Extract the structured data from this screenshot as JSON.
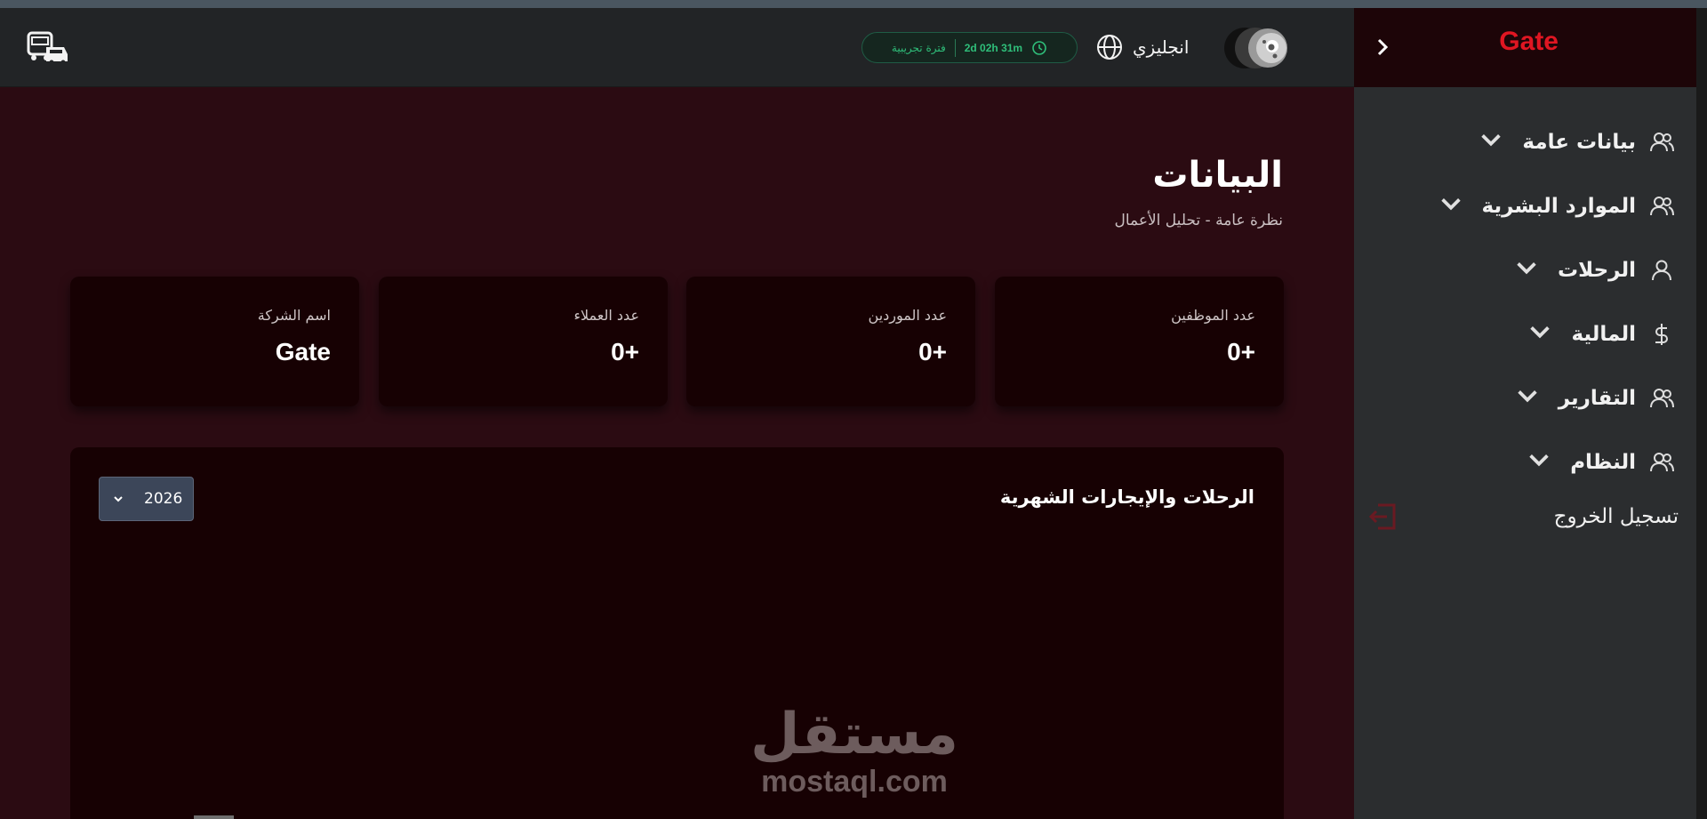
{
  "header": {
    "trial_label": "فترة تجريبية",
    "trial_time": "2d 02h 31m",
    "language_label": "انجليزي"
  },
  "sidebar": {
    "brand": "Gate",
    "items": [
      {
        "label": "بيانات عامة",
        "icon": "users-icon"
      },
      {
        "label": "الموارد البشرية",
        "icon": "users-icon"
      },
      {
        "label": "الرحلات",
        "icon": "user-icon"
      },
      {
        "label": "المالية",
        "icon": "dollar-icon"
      },
      {
        "label": "التقارير",
        "icon": "users-icon"
      },
      {
        "label": "النظام",
        "icon": "users-icon"
      }
    ],
    "logout_label": "تسجيل الخروج"
  },
  "main": {
    "title": "البيانات",
    "subtitle": "نظرة عامة - تحليل الأعمال",
    "cards": [
      {
        "label": "عدد الموظفين",
        "value": "0+"
      },
      {
        "label": "عدد الموردين",
        "value": "0+"
      },
      {
        "label": "عدد العملاء",
        "value": "0+"
      },
      {
        "label": "اسم الشركة",
        "value": "Gate"
      }
    ],
    "chart_title": "الرحلات والإيجارات الشهرية",
    "year_value": "2026"
  },
  "watermark": {
    "arabic": "مستقل",
    "latin": "mostaql.com"
  },
  "colors": {
    "brand": "#e01622",
    "trial": "#2fbf7a",
    "background": "#2b0b12",
    "card": "#170103"
  }
}
